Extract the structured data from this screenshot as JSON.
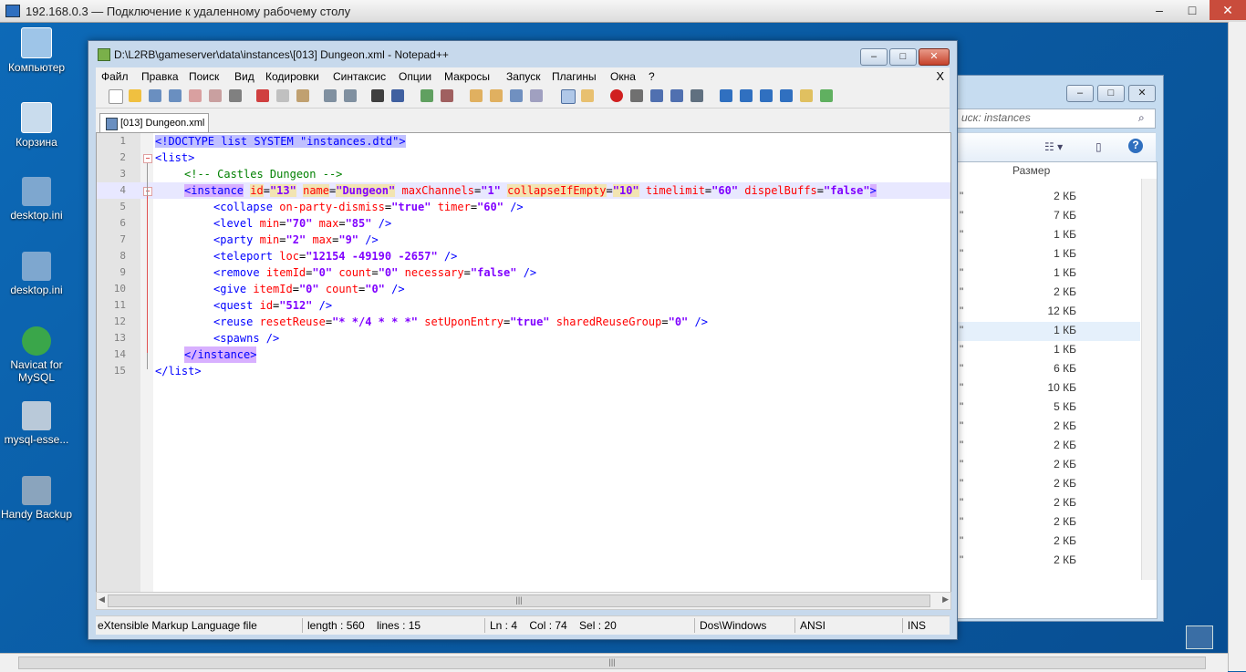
{
  "rdp": {
    "title": "192.168.0.3 — Подключение к удаленному рабочему столу",
    "btn_min": "–",
    "btn_max": "□",
    "btn_close": "✕"
  },
  "desktop_icons": [
    {
      "label": "Компьютер",
      "name": "computer-icon"
    },
    {
      "label": "Корзина",
      "name": "recycle-bin-icon"
    },
    {
      "label": "desktop.ini",
      "name": "desktop-ini-icon"
    },
    {
      "label": "desktop.ini",
      "name": "desktop-ini-icon-2"
    },
    {
      "label": "Navicat for MySQL",
      "name": "navicat-icon"
    },
    {
      "label": "mysql-esse...",
      "name": "mysql-essential-icon"
    },
    {
      "label": "Handy Backup",
      "name": "handy-backup-icon"
    }
  ],
  "explorer": {
    "search_placeholder": "иск: instances",
    "size_header": "Размер",
    "rows": [
      "2 КБ",
      "7 КБ",
      "1 КБ",
      "1 КБ",
      "1 КБ",
      "2 КБ",
      "12 КБ",
      "1 КБ",
      "1 КБ",
      "6 КБ",
      "10 КБ",
      "5 КБ",
      "2 КБ",
      "2 КБ",
      "2 КБ",
      "2 КБ",
      "2 КБ",
      "2 КБ",
      "2 КБ",
      "2 КБ"
    ],
    "quote_mark": "\""
  },
  "npp": {
    "title": "D:\\L2RB\\gameserver\\data\\instances\\[013] Dungeon.xml - Notepad++",
    "menu": [
      "Файл",
      "Правка",
      "Поиск",
      "Вид",
      "Кодировки",
      "Синтаксис",
      "Опции",
      "Макросы",
      "Запуск",
      "Плагины",
      "Окна",
      "?"
    ],
    "menu_close": "X",
    "tab_label": "[013] Dungeon.xml",
    "line_numbers": [
      "1",
      "2",
      "3",
      "4",
      "5",
      "6",
      "7",
      "8",
      "9",
      "10",
      "11",
      "12",
      "13",
      "14",
      "15"
    ],
    "status": {
      "filetype": "eXtensible Markup Language file",
      "length": "length : 560    lines : 15",
      "position": "Ln : 4    Col : 74    Sel : 20",
      "eol": "Dos\\Windows",
      "encoding": "ANSI",
      "mode": "INS"
    }
  },
  "code": {
    "l1": {
      "open": "<!DOCTYPE list SYSTEM \"",
      "dtd": "instances.dtd",
      "close": "\">"
    },
    "l2": "<list>",
    "l3": "<!-- Castles Dungeon -->",
    "l4": {
      "tag": "<instance",
      "a1": "id",
      "v1": "\"13\"",
      "a2": "name",
      "v2": "\"Dungeon\"",
      "a3": "maxChannels",
      "v3": "\"1\"",
      "a4": "collapseIfEmpty",
      "v4": "\"10\"",
      "a5": "timelimit",
      "v5": "\"60\"",
      "a6": "dispelBuffs",
      "v6": "\"false\"",
      "end": ">"
    },
    "l5": {
      "tag": "<collapse",
      "a1": "on-party-dismiss",
      "v1": "\"true\"",
      "a2": "timer",
      "v2": "\"60\"",
      "end": "/>"
    },
    "l6": {
      "tag": "<level",
      "a1": "min",
      "v1": "\"70\"",
      "a2": "max",
      "v2": "\"85\"",
      "end": "/>"
    },
    "l7": {
      "tag": "<party",
      "a1": "min",
      "v1": "\"2\"",
      "a2": "max",
      "v2": "\"9\"",
      "end": "/>"
    },
    "l8": {
      "tag": "<teleport",
      "a1": "loc",
      "v1": "\"12154 -49190 -2657\"",
      "end": "/>"
    },
    "l9": {
      "tag": "<remove",
      "a1": "itemId",
      "v1": "\"0\"",
      "a2": "count",
      "v2": "\"0\"",
      "a3": "necessary",
      "v3": "\"false\"",
      "end": "/>"
    },
    "l10": {
      "tag": "<give",
      "a1": "itemId",
      "v1": "\"0\"",
      "a2": "count",
      "v2": "\"0\"",
      "end": "/>"
    },
    "l11": {
      "tag": "<quest",
      "a1": "id",
      "v1": "\"512\"",
      "end": "/>"
    },
    "l12": {
      "tag": "<reuse",
      "a1": "resetReuse",
      "v1": "\"* */4 * * *\"",
      "a2": "setUponEntry",
      "v2": "\"true\"",
      "a3": "sharedReuseGroup",
      "v3": "\"0\"",
      "end": "/>"
    },
    "l13": "<spawns />",
    "l14": "</instance>",
    "l15": "</list>"
  },
  "colors": {
    "tag": "#0000ff",
    "attr": "#ff0000",
    "value": "#8000ff",
    "comment": "#008000"
  }
}
